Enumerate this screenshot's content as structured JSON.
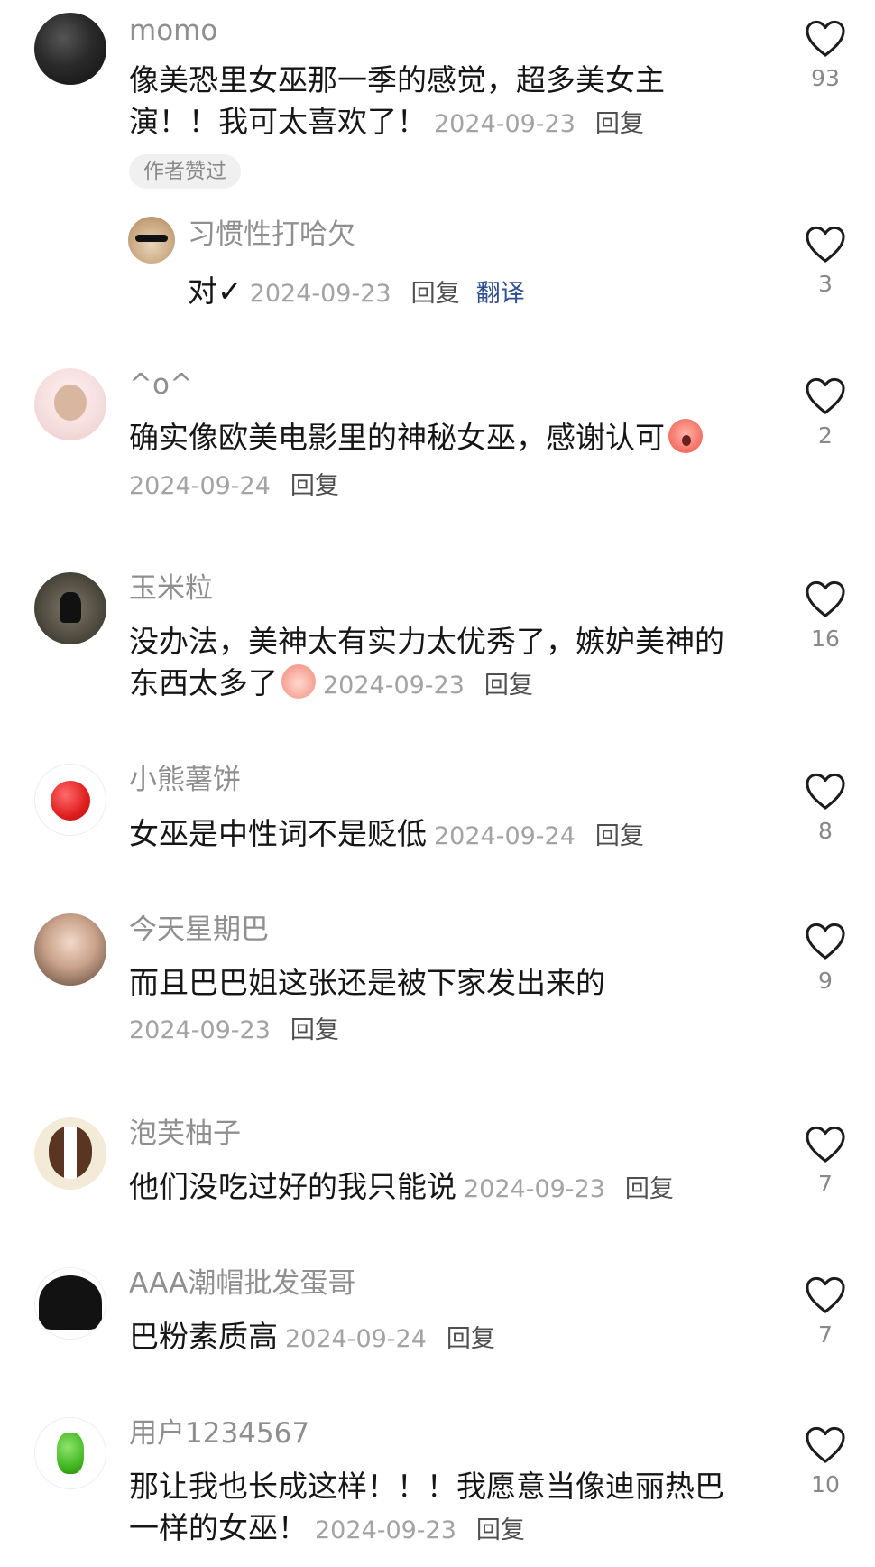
{
  "colors": {
    "accent_link": "#2f4e8f",
    "muted": "#a3a3a3",
    "name": "#8f8f8f"
  },
  "icons": {
    "like": "heart-outline-icon"
  },
  "comments": [
    {
      "user": "momo",
      "text": "像美恐里女巫那一季的感觉，超多美女主演！！我可太喜欢了！",
      "date": "2024-09-23",
      "reply": "回复",
      "likes": "93",
      "tag": "作者赞过",
      "avatar": "dark-texture"
    },
    {
      "user": "习惯性打哈欠",
      "text": "对✓",
      "date": "2024-09-23",
      "reply": "回复",
      "translate": "翻译",
      "likes": "3",
      "avatar": "cat-sunglasses",
      "is_reply": true
    },
    {
      "user": "^o^",
      "text": "确实像欧美电影里的神秘女巫，感谢认可",
      "date": "2024-09-24",
      "reply": "回复",
      "likes": "2",
      "avatar": "anime-girl",
      "emoji": "shocked-peach-emoji"
    },
    {
      "user": "玉米粒",
      "text": "没办法，美神太有实力太优秀了，嫉妒美神的东西太多了",
      "date": "2024-09-23",
      "reply": "回复",
      "likes": "16",
      "avatar": "dark-figure",
      "emoji": "peach-face-emoji"
    },
    {
      "user": "小熊薯饼",
      "text": "女巫是中性词不是贬低",
      "date": "2024-09-24",
      "reply": "回复",
      "likes": "8",
      "avatar": "red-apple"
    },
    {
      "user": "今天星期巴",
      "text": "而且巴巴姐这张还是被下家发出来的",
      "date": "2024-09-23",
      "reply": "回复",
      "likes": "9",
      "avatar": "girl-photo"
    },
    {
      "user": "泡芙柚子",
      "text": "他们没吃过好的我只能说",
      "date": "2024-09-23",
      "reply": "回复",
      "likes": "7",
      "avatar": "dog"
    },
    {
      "user": "AAA潮帽批发蛋哥",
      "text": "巴粉素质高",
      "date": "2024-09-24",
      "reply": "回复",
      "likes": "7",
      "avatar": "black-beanie"
    },
    {
      "user": "用户1234567",
      "text": "那让我也长成这样！！！我愿意当像迪丽热巴一样的女巫！",
      "date": "2024-09-23",
      "reply": "回复",
      "likes": "10",
      "avatar": "green-pepper"
    }
  ]
}
